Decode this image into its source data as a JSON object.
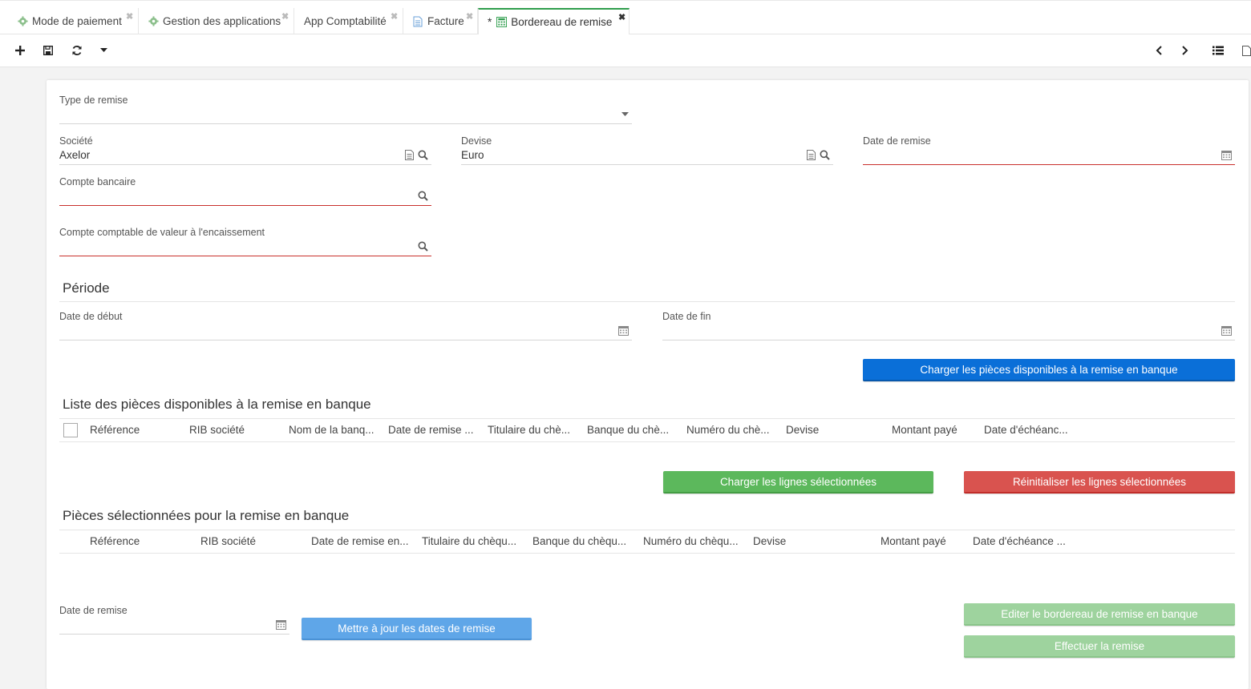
{
  "tabs": [
    {
      "label": "Mode de paiement",
      "icon": "gear-icon"
    },
    {
      "label": "Gestion des applications",
      "icon": "gear-icon"
    },
    {
      "label": "App Comptabilité",
      "icon": ""
    },
    {
      "label": "Facture",
      "icon": "document-icon"
    },
    {
      "label": "Bordereau de remise",
      "icon": "calculator-icon",
      "prefix": "*"
    }
  ],
  "colors": {
    "accent_green": "#2e9d4c",
    "primary_blue": "#0a6fd8",
    "required_red": "#c9302c"
  },
  "form": {
    "type_remise": {
      "label": "Type de remise",
      "value": ""
    },
    "societe": {
      "label": "Société",
      "value": "Axelor"
    },
    "devise": {
      "label": "Devise",
      "value": "Euro"
    },
    "date_remise": {
      "label": "Date de remise",
      "value": ""
    },
    "compte_bancaire": {
      "label": "Compte bancaire",
      "value": ""
    },
    "compte_comptable": {
      "label": "Compte comptable de valeur à l'encaissement",
      "value": ""
    },
    "periode_title": "Période",
    "date_debut": {
      "label": "Date de début",
      "value": ""
    },
    "date_fin": {
      "label": "Date de fin",
      "value": ""
    },
    "load_button": "Charger les pièces disponibles à la remise en banque",
    "available": {
      "title": "Liste des pièces disponibles à la remise en banque",
      "columns": [
        "Référence",
        "RIB société",
        "Nom de la banq...",
        "Date de remise ...",
        "Titulaire du chè...",
        "Banque du chè...",
        "Numéro du chè...",
        "Devise",
        "Montant payé",
        "Date d'échéanc..."
      ]
    },
    "load_selected_button": "Charger les lignes sélectionnées",
    "reset_selected_button": "Réinitialiser les lignes sélectionnées",
    "selected": {
      "title": "Pièces sélectionnées pour la remise en banque",
      "columns": [
        "Référence",
        "RIB société",
        "Date de remise en...",
        "Titulaire du chèqu...",
        "Banque du chèqu...",
        "Numéro du chèqu...",
        "Devise",
        "Montant payé",
        "Date d'échéance ..."
      ]
    },
    "bottom_date": {
      "label": "Date de remise",
      "value": ""
    },
    "update_dates_button": "Mettre à jour les dates de remise",
    "print_button": "Editer le bordereau de remise en banque",
    "perform_button": "Effectuer la remise"
  }
}
